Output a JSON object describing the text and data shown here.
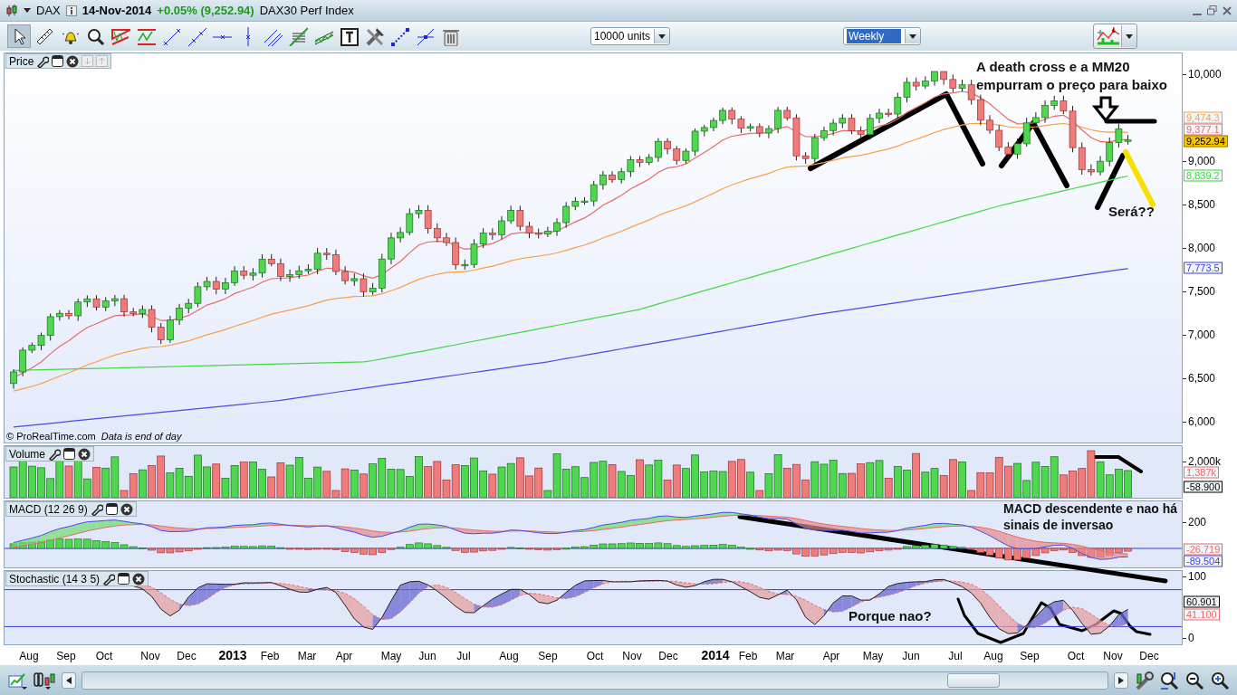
{
  "title_bar": {
    "symbol": "DAX",
    "date": "14-Nov-2014",
    "change": "+0.05% (9,252.94)",
    "instrument_name": "DAX30 Perf Index"
  },
  "toolbar": {
    "units": "10000 units",
    "timeframe": "Weekly"
  },
  "panels": [
    {
      "kind": "price",
      "title": "Price",
      "ticks": [
        "10,000",
        "9,000",
        "8,500",
        "8,000",
        "7,500",
        "7,000",
        "6,500",
        "6,000"
      ],
      "markers": [
        {
          "kind": "line",
          "text": "9,474.3",
          "color": "#f7a04a"
        },
        {
          "kind": "line",
          "text": "9,377.1",
          "color": "#e86a6a"
        },
        {
          "kind": "last",
          "text": "9,252.94",
          "color": "#f5c400"
        },
        {
          "kind": "line",
          "text": "8,839.2",
          "color": "#3fd83f"
        },
        {
          "kind": "line",
          "text": "7,773.5",
          "color": "#4040e0"
        }
      ],
      "footer": [
        "© ProRealTime.com",
        "Data is end of day"
      ]
    },
    {
      "kind": "volume",
      "title": "Volume",
      "ticks": [
        "2,000k"
      ],
      "markers": [
        {
          "kind": "line",
          "text": "1,387k",
          "color": "#e86a6a"
        },
        {
          "kind": "line",
          "text": "-58.900",
          "color": "#000000"
        }
      ]
    },
    {
      "kind": "macd",
      "title": "MACD (12 26 9)",
      "ticks": [
        "200"
      ],
      "markers": [
        {
          "kind": "line",
          "text": "-26.719",
          "color": "#e86a6a"
        },
        {
          "kind": "line",
          "text": "-89.504",
          "color": "#4040e0"
        }
      ]
    },
    {
      "kind": "stochastic",
      "title": "Stochastic (14 3 5)",
      "ticks": [
        "100",
        "0"
      ],
      "markers": [
        {
          "kind": "line",
          "text": "60.901",
          "color": "#000000"
        },
        {
          "kind": "line",
          "text": "41.100",
          "color": "#e86a6a"
        }
      ]
    }
  ],
  "x_axis": [
    {
      "label": "Aug",
      "kind": "month"
    },
    {
      "label": "Sep",
      "kind": "month"
    },
    {
      "label": "Oct",
      "kind": "month"
    },
    {
      "label": "Nov",
      "kind": "month"
    },
    {
      "label": "Dec",
      "kind": "month"
    },
    {
      "label": "2013",
      "kind": "year"
    },
    {
      "label": "Feb",
      "kind": "month"
    },
    {
      "label": "Mar",
      "kind": "month"
    },
    {
      "label": "Apr",
      "kind": "month"
    },
    {
      "label": "May",
      "kind": "month"
    },
    {
      "label": "Jun",
      "kind": "month"
    },
    {
      "label": "Jul",
      "kind": "month"
    },
    {
      "label": "Aug",
      "kind": "month"
    },
    {
      "label": "Sep",
      "kind": "month"
    },
    {
      "label": "Oct",
      "kind": "month"
    },
    {
      "label": "Nov",
      "kind": "month"
    },
    {
      "label": "Dec",
      "kind": "month"
    },
    {
      "label": "2014",
      "kind": "year"
    },
    {
      "label": "Feb",
      "kind": "month"
    },
    {
      "label": "Mar",
      "kind": "month"
    },
    {
      "label": "Apr",
      "kind": "month"
    },
    {
      "label": "May",
      "kind": "month"
    },
    {
      "label": "Jun",
      "kind": "month"
    },
    {
      "label": "Jul",
      "kind": "month"
    },
    {
      "label": "Aug",
      "kind": "month"
    },
    {
      "label": "Sep",
      "kind": "month"
    },
    {
      "label": "Oct",
      "kind": "month"
    },
    {
      "label": "Nov",
      "kind": "month"
    },
    {
      "label": "Dec",
      "kind": "month"
    }
  ],
  "annotations": [
    {
      "text": "A death cross e a MM20 empurram o preço para baixo"
    },
    {
      "text": "Será??"
    },
    {
      "text": "MACD descendente e nao há sinais de inversao"
    },
    {
      "text": "Porque nao?"
    }
  ]
}
